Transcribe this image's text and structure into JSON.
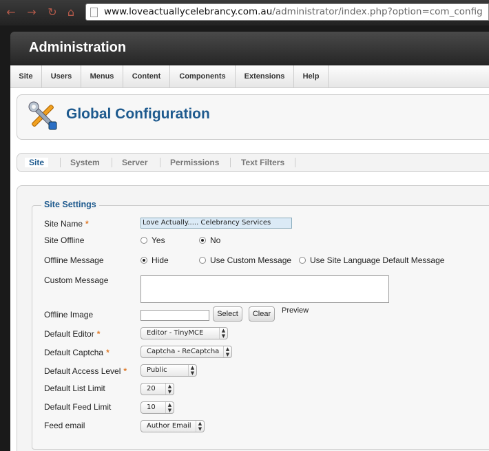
{
  "browser": {
    "url_domain": "www.loveactuallycelebrancy.com.au",
    "url_path": "/administrator/index.php?option=com_config",
    "back_icon": "arrow-left-icon",
    "forward_icon": "arrow-right-icon",
    "reload_icon": "reload-icon",
    "home_icon": "home-icon"
  },
  "header": {
    "title": "Administration"
  },
  "menu": [
    "Site",
    "Users",
    "Menus",
    "Content",
    "Components",
    "Extensions",
    "Help"
  ],
  "page": {
    "title": "Global Configuration",
    "icon": "tools-icon"
  },
  "tabs": [
    "Site",
    "System",
    "Server",
    "Permissions",
    "Text Filters"
  ],
  "form": {
    "legend": "Site Settings",
    "required_mark": "*",
    "site_name": {
      "label": "Site Name",
      "value": "Love Actually..... Celebrancy Services"
    },
    "site_offline": {
      "label": "Site Offline",
      "options": [
        "Yes",
        "No"
      ],
      "selected": "No"
    },
    "offline_message": {
      "label": "Offline Message",
      "options": [
        "Hide",
        "Use Custom Message",
        "Use Site Language Default Message"
      ],
      "selected": "Hide"
    },
    "custom_message": {
      "label": "Custom Message",
      "value": ""
    },
    "offline_image": {
      "label": "Offline Image",
      "value": "",
      "select_label": "Select",
      "clear_label": "Clear",
      "preview_label": "Preview"
    },
    "default_editor": {
      "label": "Default Editor",
      "value": "Editor - TinyMCE"
    },
    "default_captcha": {
      "label": "Default Captcha",
      "value": "Captcha - ReCaptcha"
    },
    "default_access_level": {
      "label": "Default Access Level",
      "value": "Public"
    },
    "default_list_limit": {
      "label": "Default List Limit",
      "value": "20"
    },
    "default_feed_limit": {
      "label": "Default Feed Limit",
      "value": "10"
    },
    "feed_email": {
      "label": "Feed email",
      "value": "Author Email"
    }
  },
  "colors": {
    "accent": "#1e5a8e",
    "required": "#e07b2a",
    "header": "#2e2e2e"
  }
}
